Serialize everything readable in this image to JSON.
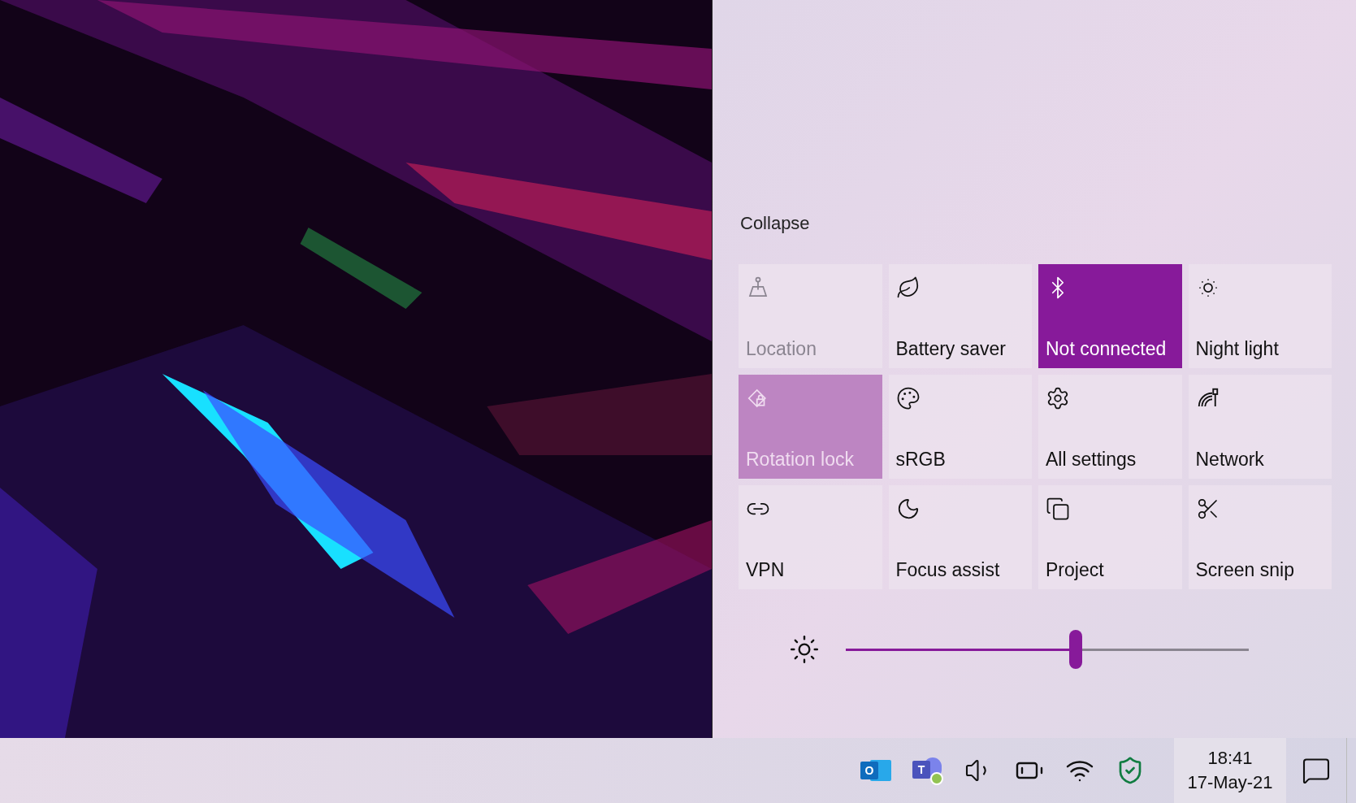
{
  "action_center": {
    "collapse_label": "Collapse",
    "tiles": [
      {
        "label": "Location",
        "on": false,
        "disabled": true
      },
      {
        "label": "Battery saver",
        "on": false,
        "disabled": false
      },
      {
        "label": "Not connected",
        "on": true,
        "disabled": false
      },
      {
        "label": "Night light",
        "on": false,
        "disabled": false
      },
      {
        "label": "Rotation lock",
        "on": true,
        "disabled": true
      },
      {
        "label": "sRGB",
        "on": false,
        "disabled": false
      },
      {
        "label": "All settings",
        "on": false,
        "disabled": false
      },
      {
        "label": "Network",
        "on": false,
        "disabled": false
      },
      {
        "label": "VPN",
        "on": false,
        "disabled": false
      },
      {
        "label": "Focus assist",
        "on": false,
        "disabled": false
      },
      {
        "label": "Project",
        "on": false,
        "disabled": false
      },
      {
        "label": "Screen snip",
        "on": false,
        "disabled": false
      }
    ],
    "brightness": {
      "level": 0.57
    }
  },
  "taskbar": {
    "outlook_letter": "O",
    "teams_letter": "T",
    "time": "18:41",
    "date": "17-May-21"
  }
}
